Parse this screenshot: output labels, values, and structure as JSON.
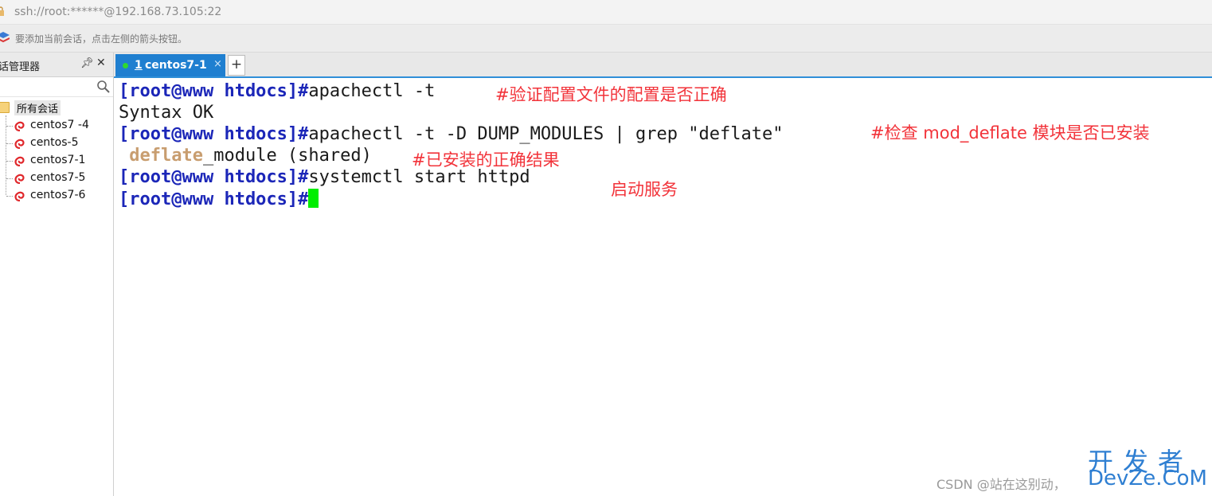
{
  "address_bar": {
    "url": "ssh://root:******@192.168.73.105:22"
  },
  "hint_bar": {
    "text": "要添加当前会话，点击左侧的箭头按钮。"
  },
  "session_manager": {
    "title": "话管理器",
    "pin_icon": "pin-icon",
    "close_icon": "close-icon",
    "root_folder": "所有会话",
    "sessions": [
      {
        "label": "centos7 -4"
      },
      {
        "label": "centos-5"
      },
      {
        "label": "centos7-1"
      },
      {
        "label": "centos7-5"
      },
      {
        "label": "centos7-6"
      }
    ]
  },
  "tabs": {
    "active": {
      "number": "1",
      "name": "centos7-1",
      "close": "×"
    },
    "add_label": "+"
  },
  "terminal": {
    "lines": [
      {
        "prompt": "[root@www htdocs]#",
        "command": "apachectl -t"
      },
      {
        "output": "Syntax OK"
      },
      {
        "prompt": "[root@www htdocs]#",
        "command": "apachectl -t -D DUMP_MODULES | grep \"deflate\""
      },
      {
        "highlight": "deflate",
        "rest": "_module (shared)"
      },
      {
        "prompt": "[root@www htdocs]#",
        "command": "systemctl start httpd"
      },
      {
        "prompt": "[root@www htdocs]#",
        "command": ""
      }
    ],
    "annotations": [
      "#验证配置文件的配置是否正确",
      "#检查 mod_deflate 模块是否已安装",
      "#已安装的正确结果",
      "启动服务"
    ]
  },
  "watermark": {
    "csdn": "CSDN @站在这别动，",
    "dev_top": "开发者",
    "dev_bottom": "DevZe.CoM"
  },
  "colors": {
    "prompt": "#1b26b8",
    "annotation": "#f2333a",
    "tab_active": "#1f7fd0",
    "cursor": "#00ee00"
  }
}
